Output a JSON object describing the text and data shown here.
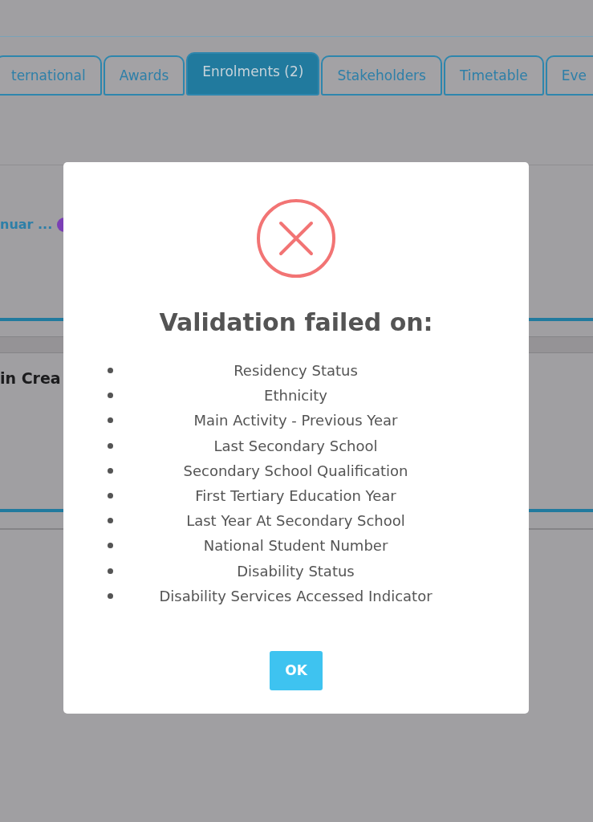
{
  "tabs": [
    {
      "label": "ternational",
      "selected": false
    },
    {
      "label": "Awards",
      "selected": false
    },
    {
      "label": "Enrolments (2)",
      "selected": true
    },
    {
      "label": "Stakeholders",
      "selected": false
    },
    {
      "label": "Timetable",
      "selected": false
    },
    {
      "label": "Eve",
      "selected": false
    }
  ],
  "background": {
    "link": "nuar ...",
    "heading": "in Crea"
  },
  "dialog": {
    "title": "Validation failed on:",
    "items": [
      "Residency Status",
      "Ethnicity",
      "Main Activity - Previous Year",
      "Last Secondary School",
      "Secondary School Qualification",
      "First Tertiary Education Year",
      "Last Year At Secondary School",
      "National Student Number",
      "Disability Status",
      "Disability Services Accessed Indicator"
    ],
    "button": "OK"
  }
}
